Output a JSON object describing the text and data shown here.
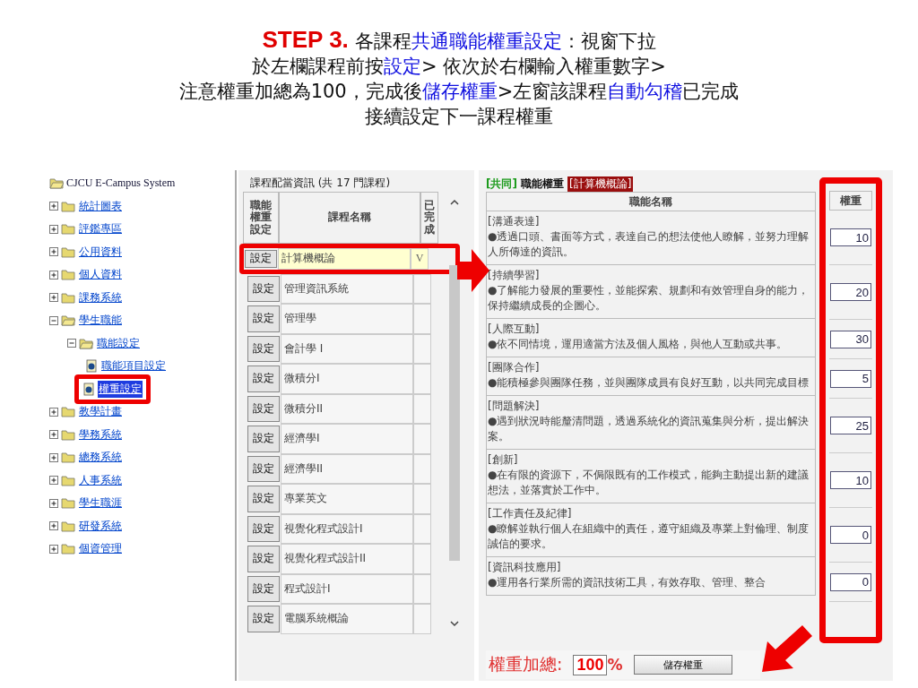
{
  "instructions": [
    [
      {
        "text": "STEP 3.",
        "kind": "step"
      },
      {
        "text": " 各課程",
        "kind": "plain"
      },
      {
        "text": "共通職能權重設定",
        "kind": "highlight"
      },
      {
        "text": "：視窗下拉",
        "kind": "plain"
      }
    ],
    [
      {
        "text": "於左欄課程前按",
        "kind": "plain"
      },
      {
        "text": "設定",
        "kind": "highlight"
      },
      {
        "text": "> 依次於右欄輸入權重數字>",
        "kind": "plain"
      }
    ],
    [
      {
        "text": "注意權重加總為100，完成後",
        "kind": "plain"
      },
      {
        "text": "儲存權重",
        "kind": "highlight"
      },
      {
        "text": ">左窗該課程",
        "kind": "plain"
      },
      {
        "text": "自動勾稽",
        "kind": "highlight"
      },
      {
        "text": "已完成",
        "kind": "plain"
      }
    ],
    [
      {
        "text": "接續設定下一課程權重",
        "kind": "plain"
      }
    ]
  ],
  "tree": {
    "root": "CJCU E-Campus System",
    "items": [
      {
        "label": "統計圖表",
        "expanded": false,
        "selected": false
      },
      {
        "label": "評鑑專區",
        "expanded": false,
        "selected": false
      },
      {
        "label": "公用資料",
        "expanded": false,
        "selected": false
      },
      {
        "label": "個人資料",
        "expanded": false,
        "selected": false
      },
      {
        "label": "課務系統",
        "expanded": false,
        "selected": false
      },
      {
        "label": "學生職能",
        "expanded": true,
        "selected": false,
        "children": [
          {
            "label": "職能設定",
            "expanded": true,
            "selected": false,
            "children": [
              {
                "label": "職能項目設定",
                "selected": false
              },
              {
                "label": "權重設定",
                "selected": true
              }
            ]
          }
        ]
      },
      {
        "label": "教學計畫",
        "expanded": false,
        "selected": false
      },
      {
        "label": "學務系統",
        "expanded": false,
        "selected": false
      },
      {
        "label": "總務系統",
        "expanded": false,
        "selected": false
      },
      {
        "label": "人事系統",
        "expanded": false,
        "selected": false
      },
      {
        "label": "學生職涯",
        "expanded": false,
        "selected": false
      },
      {
        "label": "研發系統",
        "expanded": false,
        "selected": false
      },
      {
        "label": "個資管理",
        "expanded": false,
        "selected": false
      }
    ]
  },
  "courses": {
    "legend": "課程配當資訊 (共 17 門課程)",
    "columns": [
      "職能權重設定",
      "課程名稱",
      "已完成"
    ],
    "rows": [
      {
        "button": "設定",
        "name": "計算機概論",
        "done": "V",
        "selected": true
      },
      {
        "button": "設定",
        "name": "管理資訊系統",
        "selected": false
      },
      {
        "button": "設定",
        "name": "管理學",
        "selected": false
      },
      {
        "button": "設定",
        "name": "會計學 I",
        "selected": false
      },
      {
        "button": "設定",
        "name": "微積分I",
        "selected": false
      },
      {
        "button": "設定",
        "name": "微積分II",
        "selected": false
      },
      {
        "button": "設定",
        "name": "經濟學I",
        "selected": false
      },
      {
        "button": "設定",
        "name": "經濟學II",
        "selected": false
      },
      {
        "button": "設定",
        "name": "專業英文",
        "selected": false
      },
      {
        "button": "設定",
        "name": "視覺化程式設計I",
        "selected": false
      },
      {
        "button": "設定",
        "name": "視覺化程式設計II",
        "selected": false
      },
      {
        "button": "設定",
        "name": "程式設計I",
        "selected": false
      },
      {
        "button": "設定",
        "name": "電腦系統概論",
        "selected": false
      }
    ]
  },
  "weights": {
    "tag": "[共同]",
    "title": "職能權重",
    "course": "[計算機概論]",
    "columns": [
      "職能名稱",
      "權重"
    ],
    "rows": [
      {
        "name": "[溝通表達]",
        "lines": [
          "●透過口頭、書面等方式，表達自己的想法使他人瞭解，並努力理解",
          "人所傳達的資訊。"
        ],
        "weight": "10"
      },
      {
        "name": "[持續學習]",
        "lines": [
          "●了解能力發展的重要性，並能探索、規劃和有效管理自身的能力，",
          "保持繼續成長的企圖心。"
        ],
        "weight": "20"
      },
      {
        "name": "[人際互動]",
        "lines": [
          "●依不同情境，運用適當方法及個人風格，與他人互動或共事。"
        ],
        "weight": "30"
      },
      {
        "name": "[團隊合作]",
        "lines": [
          "●能積極參與團隊任務，並與團隊成員有良好互動，以共同完成目標"
        ],
        "weight": "5"
      },
      {
        "name": "[問題解決]",
        "lines": [
          "●遇到狀況時能釐清問題，透過系統化的資訊蒐集與分析，提出解決",
          "案。"
        ],
        "weight": "25"
      },
      {
        "name": "[創新]",
        "lines": [
          "●在有限的資源下，不侷限既有的工作模式，能夠主動提出新的建議",
          "想法，並落實於工作中。"
        ],
        "weight": "10"
      },
      {
        "name": "[工作責任及紀律]",
        "lines": [
          "●瞭解並執行個人在組織中的責任，遵守組織及專業上對倫理、制度",
          "誠信的要求。"
        ],
        "weight": "0"
      },
      {
        "name": "[資訊科技應用]",
        "lines": [
          "●運用各行業所需的資訊技術工具，有效存取、管理、整合"
        ],
        "weight": "0"
      }
    ],
    "total_label": "權重加總:",
    "total": "100",
    "percent": "%",
    "save": "儲存權重"
  }
}
